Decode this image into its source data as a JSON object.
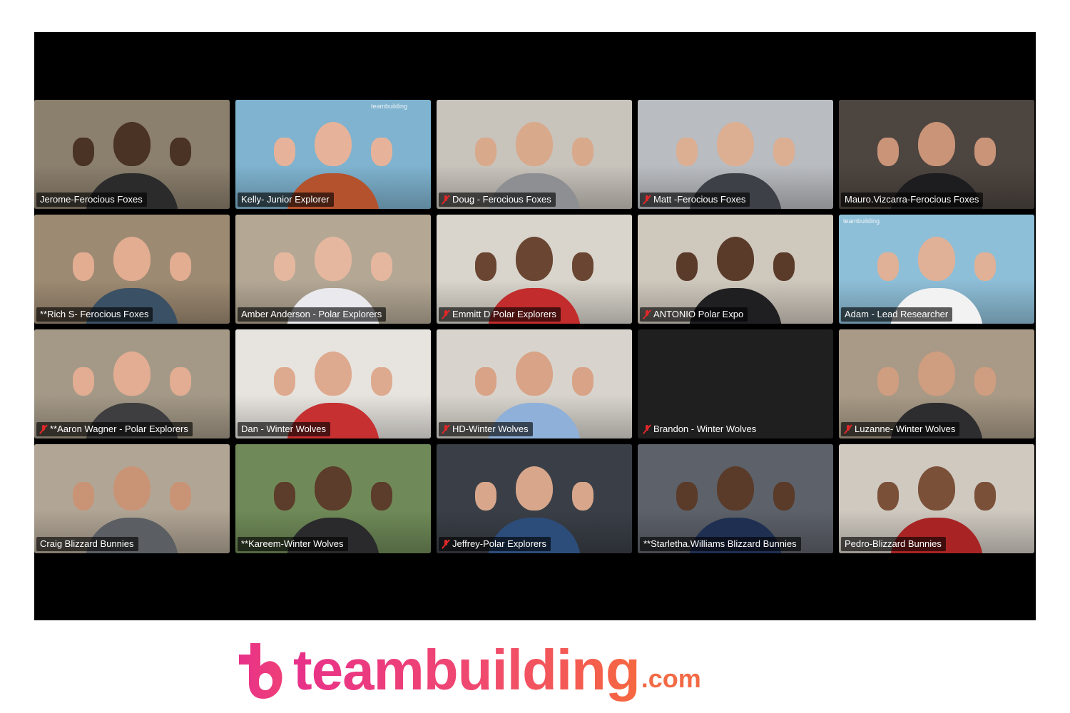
{
  "meeting": {
    "participants": [
      {
        "name": "Jerome-Ferocious Foxes",
        "muted": false,
        "active": false,
        "bg": "#8b7f6d",
        "skin": "#4a3224",
        "shirt": "#2b2b2b"
      },
      {
        "name": "Kelly- Junior Explorer",
        "muted": false,
        "active": true,
        "bg": "#7fb3cf",
        "skin": "#e7b29a",
        "shirt": "#b5522e",
        "watermark": "teambuilding"
      },
      {
        "name": "Doug - Ferocious Foxes",
        "muted": true,
        "active": false,
        "bg": "#c8c3bb",
        "skin": "#d9a98c",
        "shirt": "#8d8f93"
      },
      {
        "name": "Matt -Ferocious Foxes",
        "muted": true,
        "active": false,
        "bg": "#b9bcc0",
        "skin": "#dcae92",
        "shirt": "#3d4046"
      },
      {
        "name": "Mauro.Vizcarra-Ferocious Foxes",
        "muted": false,
        "active": false,
        "bg": "#4d4540",
        "skin": "#c99478",
        "shirt": "#1d1d1f"
      },
      {
        "name": "**Rich S- Ferocious Foxes",
        "muted": false,
        "active": false,
        "bg": "#9d8a72",
        "skin": "#e3ad92",
        "shirt": "#3a5065"
      },
      {
        "name": "Amber Anderson - Polar Explorers",
        "muted": false,
        "active": false,
        "bg": "#b4a895",
        "skin": "#e6b79f",
        "shirt": "#e9e9ee"
      },
      {
        "name": "Emmitt D Polar Explorers",
        "muted": true,
        "active": false,
        "bg": "#d9d5cc",
        "skin": "#6a4632",
        "shirt": "#c22c2c"
      },
      {
        "name": "ANTONIO Polar Expo",
        "muted": true,
        "active": false,
        "bg": "#cfc8bd",
        "skin": "#5a3b2a",
        "shirt": "#1f1f22"
      },
      {
        "name": "Adam - Lead Researcher",
        "muted": false,
        "active": false,
        "bg": "#8ebfd8",
        "skin": "#e0b196",
        "shirt": "#f2f2f2",
        "watermark": "teambuilding"
      },
      {
        "name": "**Aaron Wagner - Polar Explorers",
        "muted": true,
        "active": false,
        "bg": "#a49987",
        "skin": "#e2ad92",
        "shirt": "#3e3e40"
      },
      {
        "name": "Dan - Winter Wolves",
        "muted": false,
        "active": false,
        "bg": "#e7e4df",
        "skin": "#deaa8f",
        "shirt": "#c63030"
      },
      {
        "name": "HD-Winter Wolves",
        "muted": true,
        "active": false,
        "bg": "#d8d4cd",
        "skin": "#d8a386",
        "shirt": "#8fb0d9"
      },
      {
        "name": "Brandon - Winter Wolves",
        "muted": true,
        "active": false,
        "empty": true
      },
      {
        "name": "Luzanne- Winter Wolves",
        "muted": true,
        "active": false,
        "bg": "#a89a86",
        "skin": "#cf9d80",
        "shirt": "#2d2d30"
      },
      {
        "name": "Craig Blizzard Bunnies",
        "muted": false,
        "active": false,
        "bg": "#b1a595",
        "skin": "#c99476",
        "shirt": "#5b5f63"
      },
      {
        "name": "**Kareem-Winter Wolves",
        "muted": false,
        "active": false,
        "bg": "#6f8a58",
        "skin": "#5c3c2a",
        "shirt": "#2a2a2c"
      },
      {
        "name": "Jeffrey-Polar Explorers",
        "muted": true,
        "active": false,
        "bg": "#3a3f47",
        "skin": "#d8a78b",
        "shirt": "#2c4d7a"
      },
      {
        "name": "**Starletha.Williams Blizzard Bunnies",
        "muted": false,
        "active": false,
        "bg": "#5d6169",
        "skin": "#5a3a28",
        "shirt": "#1e2f52"
      },
      {
        "name": "Pedro-Blizzard Bunnies",
        "muted": false,
        "active": false,
        "bg": "#cfc9c0",
        "skin": "#7b5038",
        "shirt": "#a82424"
      }
    ]
  },
  "brand": {
    "wordmark": "teambuilding",
    "suffix": ".com",
    "colors": {
      "start": "#e8318a",
      "end": "#f6683f"
    }
  }
}
